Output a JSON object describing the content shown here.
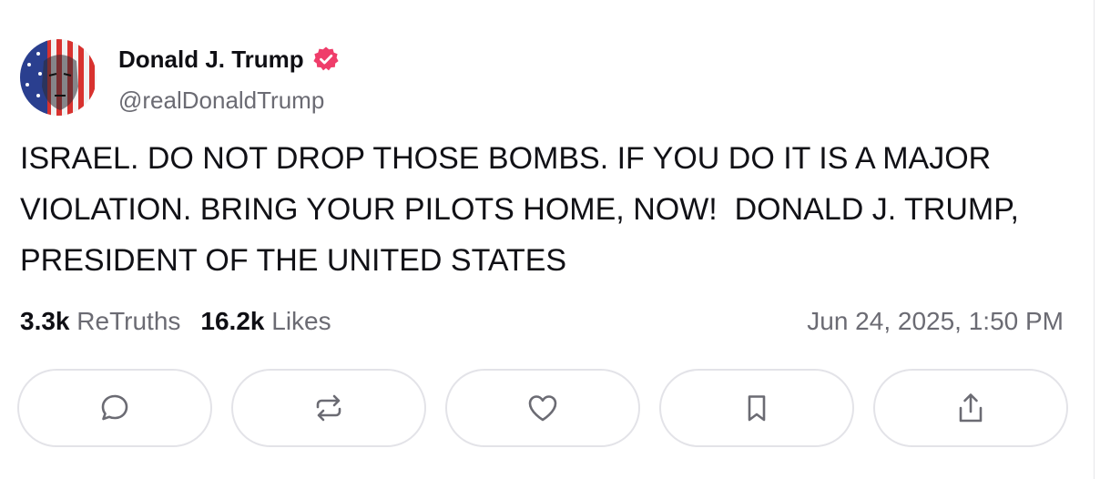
{
  "user": {
    "display_name": "Donald J. Trump",
    "handle": "@realDonaldTrump",
    "verified": true
  },
  "post": {
    "text": "ISRAEL. DO NOT DROP THOSE BOMBS. IF YOU DO IT IS A MAJOR VIOLATION. BRING YOUR PILOTS HOME, NOW!  DONALD J. TRUMP, PRESIDENT OF THE UNITED STATES",
    "timestamp": "Jun 24, 2025, 1:50 PM"
  },
  "stats": {
    "retruths_count": "3.3k",
    "retruths_label": "ReTruths",
    "likes_count": "16.2k",
    "likes_label": "Likes"
  },
  "actions": [
    {
      "icon": "reply-icon"
    },
    {
      "icon": "retruth-icon"
    },
    {
      "icon": "heart-icon"
    },
    {
      "icon": "bookmark-icon"
    },
    {
      "icon": "share-icon"
    }
  ],
  "colors": {
    "verified_badge": "#ef3d6a",
    "text_primary": "#111116",
    "text_secondary": "#6b6b73",
    "button_border": "#e3e3e8"
  }
}
